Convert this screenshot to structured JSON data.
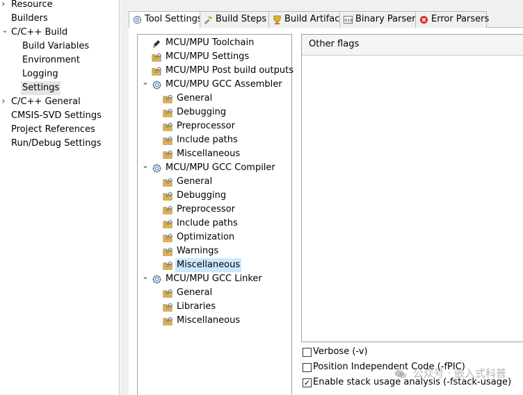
{
  "left_nav": {
    "items": [
      {
        "label": "Resource",
        "expandable": true,
        "expanded": false,
        "indent": 1
      },
      {
        "label": "Builders",
        "expandable": false,
        "indent": 1
      },
      {
        "label": "C/C++ Build",
        "expandable": true,
        "expanded": true,
        "indent": 1
      },
      {
        "label": "Build Variables",
        "expandable": false,
        "indent": 2
      },
      {
        "label": "Environment",
        "expandable": false,
        "indent": 2
      },
      {
        "label": "Logging",
        "expandable": false,
        "indent": 2
      },
      {
        "label": "Settings",
        "expandable": false,
        "indent": 2,
        "selected": true
      },
      {
        "label": "C/C++ General",
        "expandable": true,
        "expanded": false,
        "indent": 1
      },
      {
        "label": "CMSIS-SVD Settings",
        "expandable": false,
        "indent": 1
      },
      {
        "label": "Project References",
        "expandable": false,
        "indent": 1
      },
      {
        "label": "Run/Debug Settings",
        "expandable": false,
        "indent": 1
      }
    ]
  },
  "tabs": [
    {
      "label": "Tool Settings",
      "icon": "tool-settings-icon",
      "active": true
    },
    {
      "label": "Build Steps",
      "icon": "build-steps-icon",
      "active": false
    },
    {
      "label": "Build Artifact",
      "icon": "build-artifact-icon",
      "active": false
    },
    {
      "label": "Binary Parsers",
      "icon": "binary-parsers-icon",
      "active": false
    },
    {
      "label": "Error Parsers",
      "icon": "error-parsers-icon",
      "active": false
    }
  ],
  "tool_tree": {
    "nodes": [
      {
        "label": "MCU/MPU Toolchain",
        "level": 0,
        "icon": "toolchain-icon"
      },
      {
        "label": "MCU/MPU Settings",
        "level": 0,
        "icon": "option-category-icon"
      },
      {
        "label": "MCU/MPU Post build outputs",
        "level": 0,
        "icon": "option-category-icon"
      },
      {
        "label": "MCU/MPU GCC Assembler",
        "level": 0,
        "icon": "tool-gear-icon",
        "expanded": true
      },
      {
        "label": "General",
        "level": 1,
        "icon": "option-category-icon"
      },
      {
        "label": "Debugging",
        "level": 1,
        "icon": "option-category-icon"
      },
      {
        "label": "Preprocessor",
        "level": 1,
        "icon": "option-category-icon"
      },
      {
        "label": "Include paths",
        "level": 1,
        "icon": "option-category-icon"
      },
      {
        "label": "Miscellaneous",
        "level": 1,
        "icon": "option-category-icon"
      },
      {
        "label": "MCU/MPU GCC Compiler",
        "level": 0,
        "icon": "tool-gear-icon",
        "expanded": true
      },
      {
        "label": "General",
        "level": 1,
        "icon": "option-category-icon"
      },
      {
        "label": "Debugging",
        "level": 1,
        "icon": "option-category-icon"
      },
      {
        "label": "Preprocessor",
        "level": 1,
        "icon": "option-category-icon"
      },
      {
        "label": "Include paths",
        "level": 1,
        "icon": "option-category-icon"
      },
      {
        "label": "Optimization",
        "level": 1,
        "icon": "option-category-icon"
      },
      {
        "label": "Warnings",
        "level": 1,
        "icon": "option-category-icon"
      },
      {
        "label": "Miscellaneous",
        "level": 1,
        "icon": "option-category-icon",
        "selected": true
      },
      {
        "label": "MCU/MPU GCC Linker",
        "level": 0,
        "icon": "tool-gear-icon",
        "expanded": true
      },
      {
        "label": "General",
        "level": 1,
        "icon": "option-category-icon"
      },
      {
        "label": "Libraries",
        "level": 1,
        "icon": "option-category-icon"
      },
      {
        "label": "Miscellaneous",
        "level": 1,
        "icon": "option-category-icon"
      }
    ]
  },
  "options_panel": {
    "other_flags_label": "Other flags",
    "checkboxes": [
      {
        "label": "Verbose (-v)",
        "checked": false
      },
      {
        "label": "Position Independent Code (-fPIC)",
        "checked": false
      },
      {
        "label": "Enable stack usage analysis (-fstack-usage)",
        "checked": true
      }
    ]
  },
  "watermark": {
    "text": "公众号 · 嵌入式科普"
  },
  "colors": {
    "selection": "#cce8ff",
    "nav_selection": "#e5e5e5",
    "folder": "#e8b84a"
  }
}
